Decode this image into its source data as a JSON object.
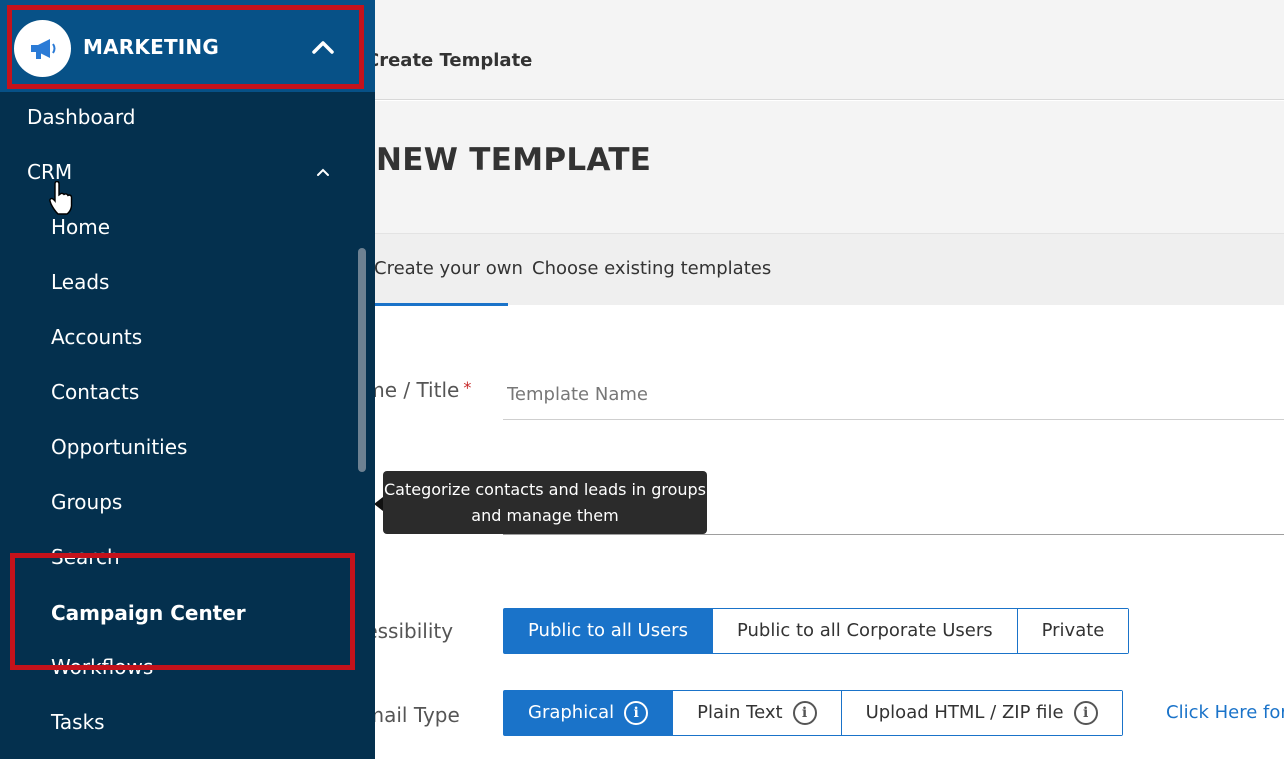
{
  "sidebar": {
    "module_title": "MARKETING",
    "colors": {
      "background": "#04304e",
      "header": "#075187"
    },
    "items": [
      {
        "label": "Dashboard"
      },
      {
        "label": "CRM"
      }
    ],
    "crm_children": [
      {
        "label": "Home"
      },
      {
        "label": "Leads"
      },
      {
        "label": "Accounts"
      },
      {
        "label": "Contacts"
      },
      {
        "label": "Opportunities"
      },
      {
        "label": "Groups"
      },
      {
        "label": "Search"
      },
      {
        "label": "Campaign Center"
      },
      {
        "label": "Workflows"
      },
      {
        "label": "Tasks"
      }
    ],
    "icons": {
      "logo": "megaphone-icon",
      "collapse": "chevron-up-icon",
      "crm_toggle": "chevron-up-icon"
    }
  },
  "header": {
    "breadcrumb_current": "Create Template"
  },
  "page": {
    "title": "NEW TEMPLATE"
  },
  "tabs": [
    {
      "label": "Create your own",
      "active": true
    },
    {
      "label": "Choose existing templates",
      "active": false
    }
  ],
  "form": {
    "name_label": "Name / Title",
    "required_mark": "*",
    "name_placeholder": "Template Name",
    "name_value": "",
    "tooltip": "Categorize contacts and leads in groups and manage them",
    "accessibility_label": "Accessibility",
    "accessibility_options": [
      {
        "label": "Public to all Users",
        "selected": true
      },
      {
        "label": "Public to all Corporate Users",
        "selected": false
      },
      {
        "label": "Private",
        "selected": false
      }
    ],
    "email_type_label": "Email Type",
    "email_type_options": [
      {
        "label": "Graphical",
        "selected": true
      },
      {
        "label": "Plain Text",
        "selected": false
      },
      {
        "label": "Upload HTML / ZIP file",
        "selected": false
      }
    ],
    "info_glyph": "i",
    "click_here_link": "Click Here for"
  },
  "accent_color": "#1a73c9",
  "annotation_color": "#c4121b"
}
